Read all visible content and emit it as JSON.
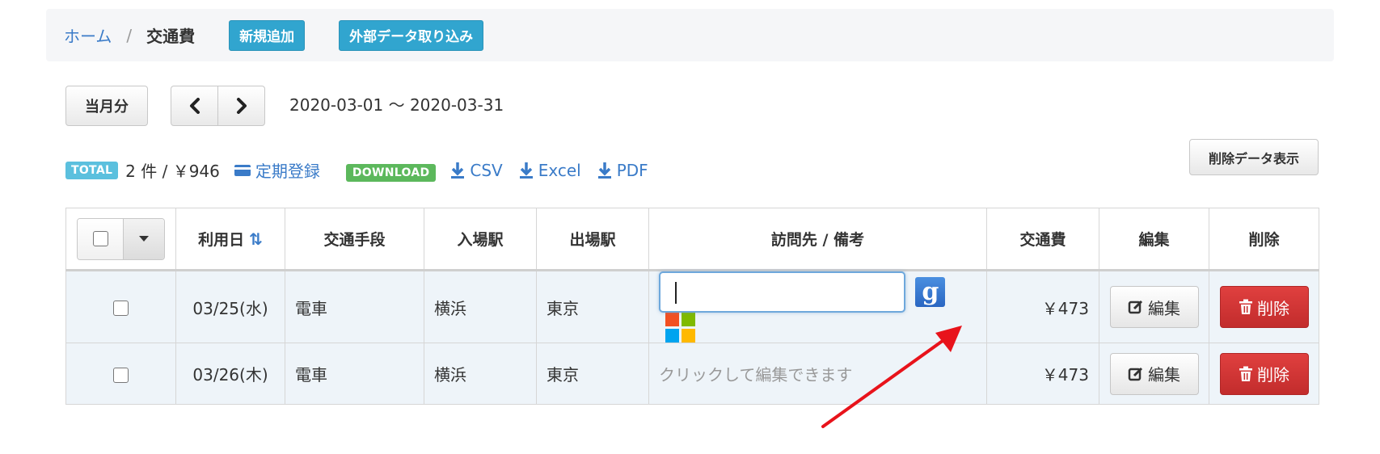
{
  "breadcrumb": {
    "home": "ホーム",
    "separator": "/",
    "current": "交通費"
  },
  "actions": {
    "new": "新規追加",
    "import": "外部データ取り込み"
  },
  "period": {
    "current_month": "当月分",
    "range": "2020-03-01 〜 2020-03-31"
  },
  "totals": {
    "total_label": "TOTAL",
    "summary": "2 件 / ￥946",
    "periodic_register": "定期登録",
    "download_label": "DOWNLOAD",
    "csv": "CSV",
    "excel": "Excel",
    "pdf": "PDF"
  },
  "show_deleted": "削除データ表示",
  "table": {
    "headers": {
      "date": "利用日",
      "transport": "交通手段",
      "entry": "入場駅",
      "exit": "出場駅",
      "memo": "訪問先 / 備考",
      "cost": "交通費",
      "edit": "編集",
      "delete": "削除"
    },
    "rows": [
      {
        "date": "03/25(水)",
        "transport": "電車",
        "entry": "横浜",
        "exit": "東京",
        "memo": "",
        "cost": "￥473",
        "edit": "編集",
        "delete": "削除"
      },
      {
        "date": "03/26(木)",
        "transport": "電車",
        "entry": "横浜",
        "exit": "東京",
        "memo": "クリックして編集できます",
        "cost": "￥473",
        "edit": "編集",
        "delete": "削除"
      }
    ]
  },
  "icons": {
    "google": "g",
    "microsoft_colors": [
      "#f25022",
      "#7fba00",
      "#00a4ef",
      "#ffb900"
    ]
  },
  "colors": {
    "link": "#3a7bc8",
    "info": "#31a5cf",
    "success": "#5cb85c",
    "danger": "#d9363e",
    "annotation_arrow": "#e8131b"
  }
}
